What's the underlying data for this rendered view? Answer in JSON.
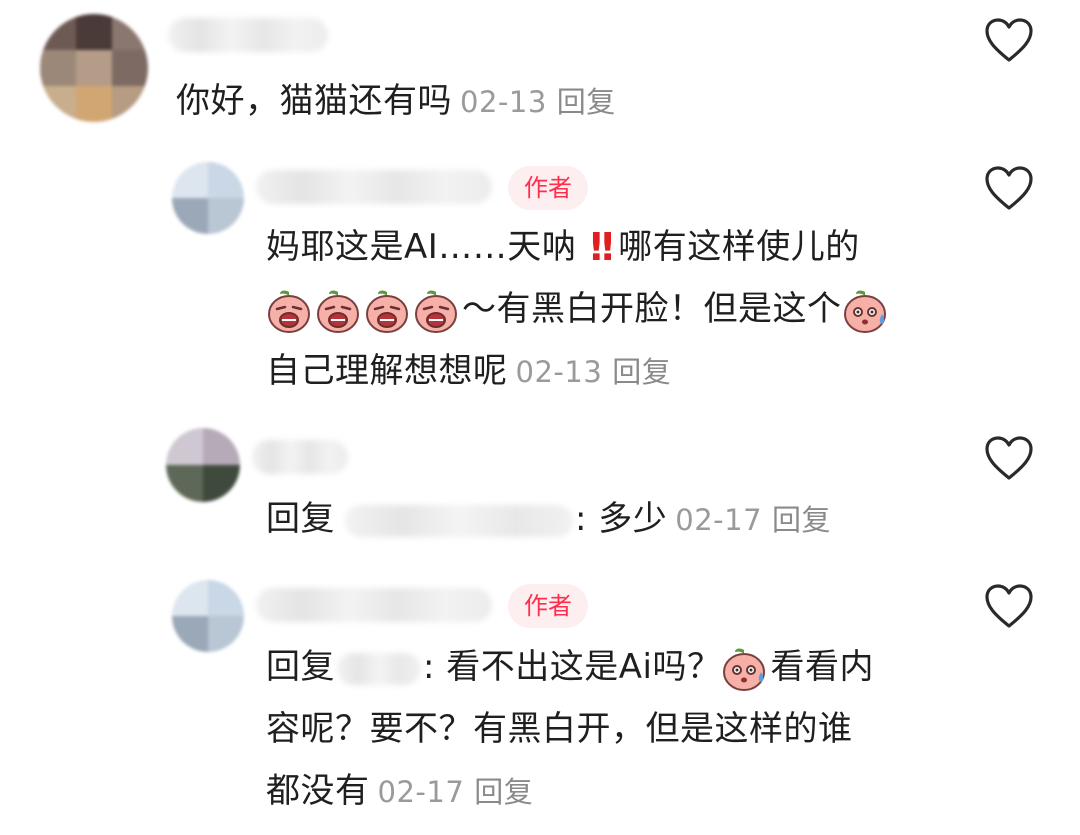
{
  "comments": [
    {
      "text": "你好，猫猫还有吗",
      "date": "02-13",
      "reply_label": "回复"
    },
    {
      "badge": "作者",
      "line1_a": "妈耶这是AI……天呐",
      "line1_b": "哪有这样使儿的",
      "line2": "～有黑白开脸！但是这个",
      "line3": "自己理解想想呢",
      "date": "02-13",
      "reply_label": "回复"
    },
    {
      "prefix": "回复",
      "text": ": 多少",
      "date": "02-17",
      "reply_label": "回复"
    },
    {
      "badge": "作者",
      "prefix": "回复",
      "line1_a": ": 看不出这是Ai吗？",
      "line1_b": "看看内",
      "line2": "容呢？要不？有黑白开，但是这样的谁",
      "line3": "都没有",
      "date": "02-17",
      "reply_label": "回复"
    }
  ],
  "icons": {
    "like": "heart-outline-icon",
    "double_exclamation": "double-exclamation-icon",
    "crying_sticker": "crying-peach-sticker",
    "sweat_sticker": "sweat-peach-sticker"
  },
  "colors": {
    "author_badge_text": "#ff2e4d",
    "author_badge_bg": "#fdeef0",
    "meta_text": "#9a9a9a"
  }
}
